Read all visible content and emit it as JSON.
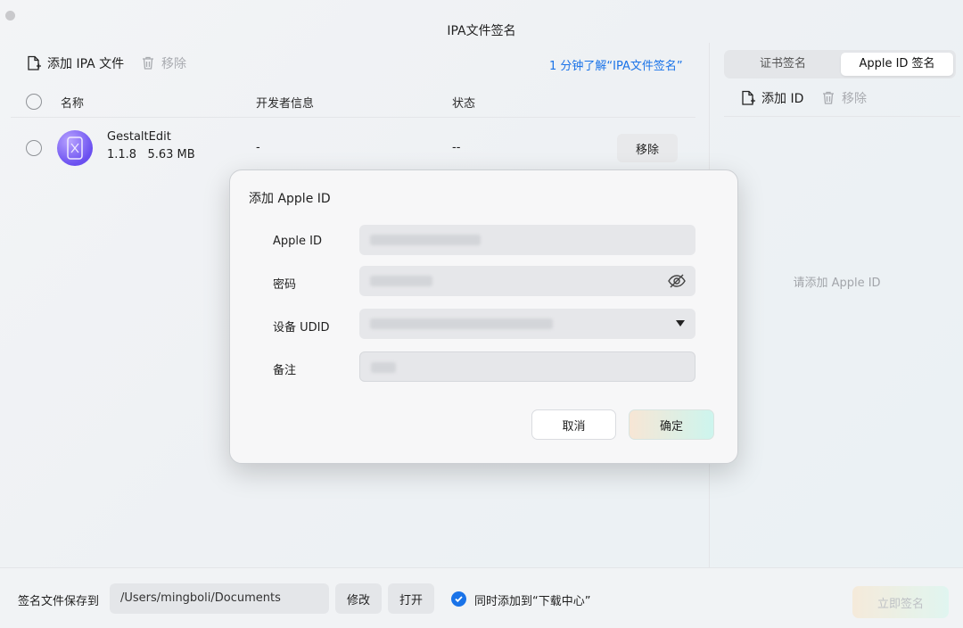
{
  "window": {
    "title": "IPA文件签名"
  },
  "toolbar": {
    "add_ipa_label": "添加 IPA 文件",
    "remove_label": "移除",
    "learn_link": "1 分钟了解“IPA文件签名”"
  },
  "table": {
    "columns": [
      "名称",
      "开发者信息",
      "状态"
    ],
    "rows": [
      {
        "name": "GestaltEdit",
        "version": "1.1.8",
        "size": "5.63 MB",
        "developer": "-",
        "status": "--",
        "action": "移除"
      }
    ]
  },
  "right_panel": {
    "tabs": [
      {
        "label": "证书签名",
        "active": false
      },
      {
        "label": "Apple ID 签名",
        "active": true
      }
    ],
    "add_id_label": "添加 ID",
    "remove_label": "移除",
    "empty_hint": "请添加 Apple ID"
  },
  "dialog": {
    "title": "添加 Apple ID",
    "fields": {
      "apple_id_label": "Apple ID",
      "password_label": "密码",
      "udid_label": "设备 UDID",
      "note_label": "备注"
    },
    "cancel_label": "取消",
    "ok_label": "确定"
  },
  "bottom": {
    "save_to_label": "签名文件保存到",
    "path": "/Users/mingboli/Documents",
    "modify_label": "修改",
    "open_label": "打开",
    "add_to_download_label": "同时添加到“下载中心”",
    "add_to_download_checked": true,
    "sign_now_label": "立即签名"
  },
  "colors": {
    "accent": "#1a73e8",
    "icon_purple": "#6a4ff0"
  }
}
